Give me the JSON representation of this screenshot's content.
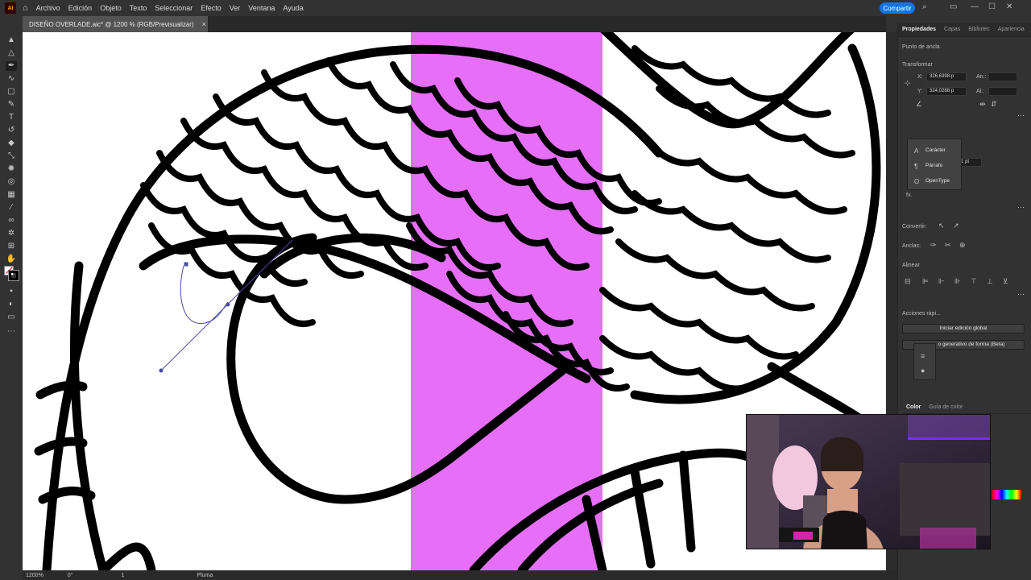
{
  "app": {
    "logo": "Ai"
  },
  "menu": {
    "items": [
      "Archivo",
      "Edición",
      "Objeto",
      "Texto",
      "Seleccionar",
      "Efecto",
      "Ver",
      "Ventana",
      "Ayuda"
    ]
  },
  "topbar": {
    "share_label": "Compartir"
  },
  "document": {
    "tab_title": "DISEÑO OVERLADE.aic* @ 1200 % (RGB/Previsualizar)",
    "close": "×"
  },
  "panel": {
    "tabs": [
      "Propiedades",
      "Capas",
      "Bibliotec",
      "Apariencia"
    ],
    "anchor_label": "Punto de ancla",
    "transform_label": "Transformar",
    "x_label": "X:",
    "x_value": "326,6398 p",
    "y_label": "Y:",
    "y_value": "324,0288 p",
    "w_label": "An.:",
    "h_label": "Al.:",
    "stroke_value": "1 pt",
    "convert_label": "Convertir:",
    "anchors_label": "Anclas:",
    "align_label": "Alinear",
    "quick_actions_label": "Acciones rápi...",
    "global_edit_btn": "Iniciar edición global",
    "generative_btn": "o generativo de forma (Beta)",
    "fx": "fx.",
    "color_tabs": [
      "Color",
      "Guía de color"
    ]
  },
  "popup": {
    "items": [
      "Carácter",
      "Párrafo",
      "OpenType"
    ]
  },
  "status": {
    "zoom": "1200%",
    "rotation": "0°",
    "artboard": "1",
    "tool": "Pluma"
  },
  "colors": {
    "accent": "#1473e6",
    "magenta": "#e66ef8",
    "canvas": "#ffffff",
    "ui_bg": "#323232"
  },
  "icons": [
    "home-icon",
    "search-icon",
    "arrange-icon",
    "minimize-icon",
    "maximize-icon",
    "close-icon",
    "selection-tool-icon",
    "direct-selection-icon",
    "pen-tool-icon",
    "curvature-tool-icon",
    "rectangle-tool-icon",
    "brush-icon",
    "type-tool-icon",
    "rotate-icon",
    "eraser-icon",
    "scale-icon",
    "warp-icon",
    "shape-builder-icon",
    "gradient-icon",
    "eyedropper-icon",
    "blend-icon",
    "symbol-sprayer-icon",
    "artboard-icon",
    "hand-icon",
    "zoom-icon",
    "fill-stroke-icon"
  ]
}
